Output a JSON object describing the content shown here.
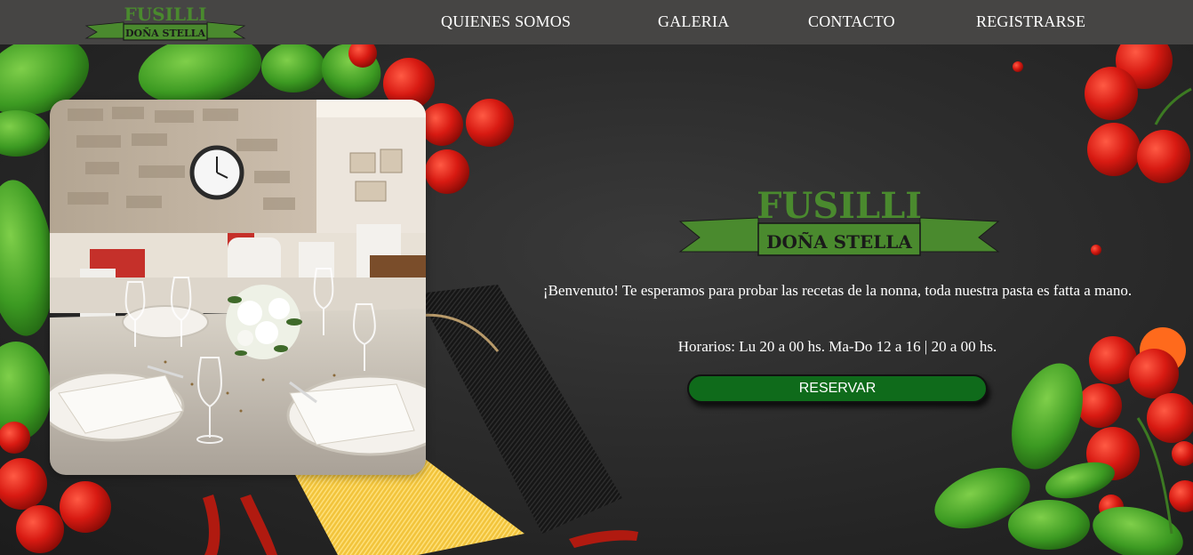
{
  "brand": {
    "name": "FUSILLI",
    "ribbon": "DOÑA STELLA",
    "colors": {
      "brand_green": "#4a8a2e",
      "dark_green_button": "#0f6b1b",
      "navbar": "#464544"
    }
  },
  "nav": {
    "items": [
      {
        "label": "QUIENES SOMOS"
      },
      {
        "label": "GALERIA"
      },
      {
        "label": "CONTACTO"
      },
      {
        "label": "REGISTRARSE"
      }
    ]
  },
  "hero": {
    "welcome": "¡Benvenuto! Te esperamos para probar las recetas de la nonna, toda nuestra pasta es fatta a mano.",
    "hours": "Horarios: Lu 20 a 00 hs. Ma-Do 12 a 16 | 20 a 00 hs.",
    "reserve_label": "RESERVAR"
  },
  "icons": {
    "logo": "fusilli-logo-icon",
    "photo": "restaurant-dining-room-photo"
  }
}
